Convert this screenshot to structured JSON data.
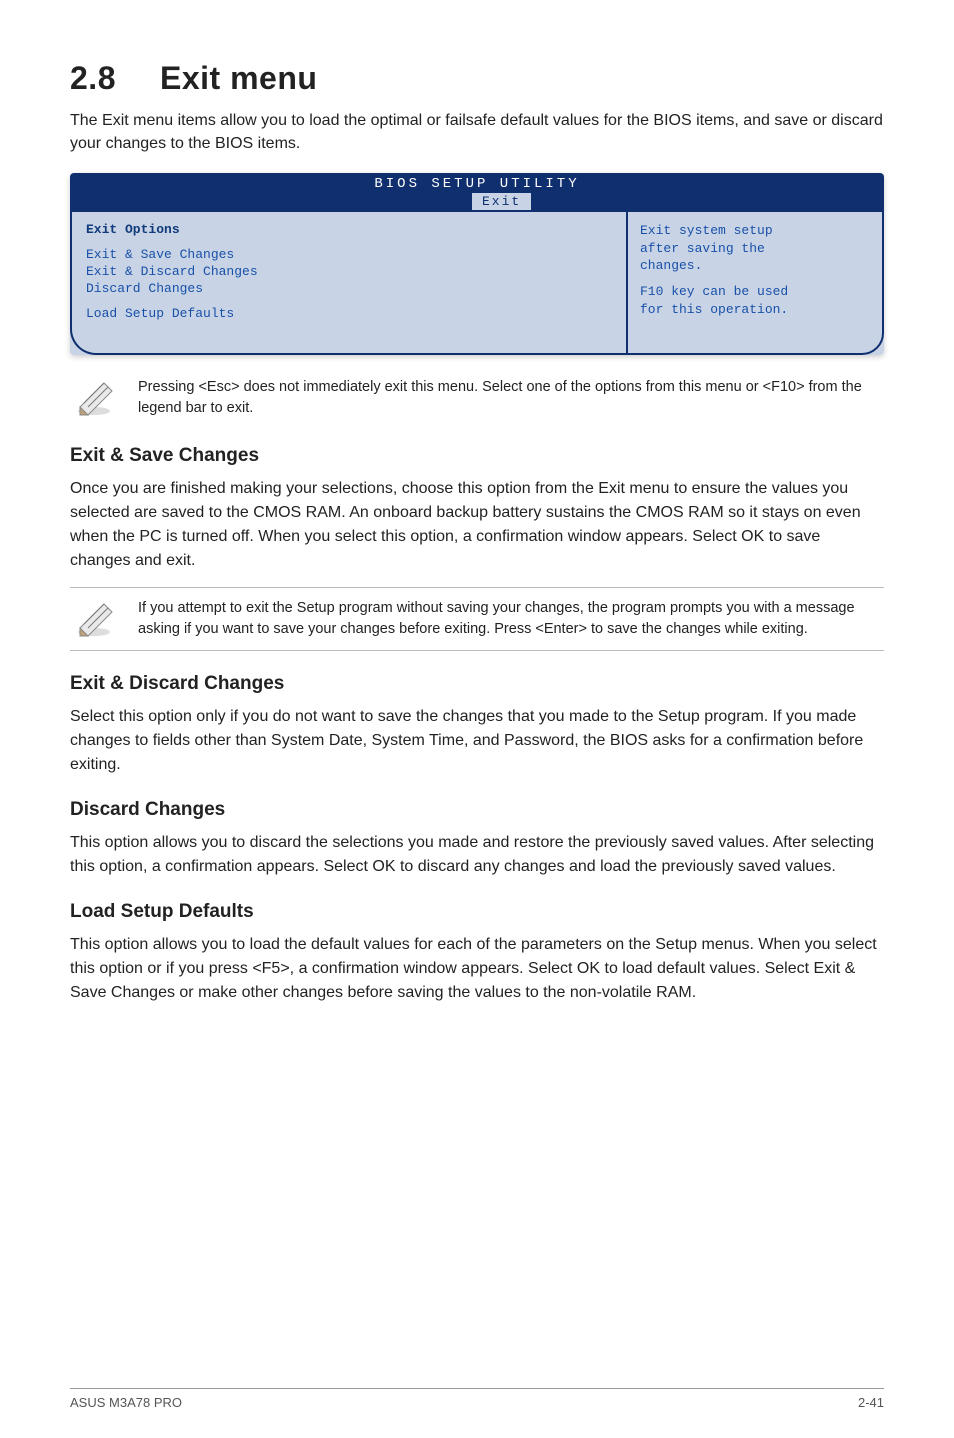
{
  "section": {
    "number": "2.8",
    "title": "Exit menu"
  },
  "intro": "The Exit menu items allow you to load the optimal or failsafe default values for the BIOS items, and save or discard your changes to the BIOS items.",
  "bios": {
    "utility_title": "BIOS SETUP UTILITY",
    "tab": "Exit",
    "left_header": "Exit Options",
    "left_items": [
      "Exit & Save Changes",
      "Exit & Discard Changes",
      "Discard Changes",
      "Load Setup Defaults"
    ],
    "right_lines": [
      "Exit system setup",
      "after saving the",
      "changes.",
      "",
      "F10 key can be used",
      "for this operation."
    ]
  },
  "note1": "Pressing <Esc> does not immediately exit this menu. Select one of the options from this menu or <F10> from the legend bar to exit.",
  "h_save": "Exit & Save Changes",
  "p_save": "Once you are finished making your selections, choose this option from the Exit menu to ensure the values you selected are saved to the CMOS RAM. An onboard backup battery sustains the CMOS RAM so it stays on even when the PC is turned off. When you select this option, a confirmation window appears. Select OK to save changes and exit.",
  "note2": " If you attempt to exit the Setup program without saving your changes, the program prompts you with a message asking if you want to save your changes before exiting. Press <Enter>  to save the  changes while exiting.",
  "h_discardexit": "Exit & Discard Changes",
  "p_discardexit": "Select this option only if you do not want to save the changes that you  made to the Setup program. If you made changes to fields other than System Date, System Time, and Password, the BIOS asks for a confirmation before exiting.",
  "h_discard": "Discard Changes",
  "p_discard": "This option allows you to discard the selections you made and restore the previously saved values. After selecting this option, a confirmation appears. Select OK to discard any changes and load the previously saved values.",
  "h_load": "Load Setup Defaults",
  "p_load": "This option allows you to load the default values for each of the parameters on the Setup menus. When you select this option or if you press <F5>, a confirmation window appears. Select OK to load default values. Select Exit & Save Changes or make other changes before saving the values to the non-volatile RAM.",
  "footer": {
    "left": "ASUS M3A78 PRO",
    "right": "2-41"
  },
  "icons": {
    "pencil": "pencil-icon"
  }
}
